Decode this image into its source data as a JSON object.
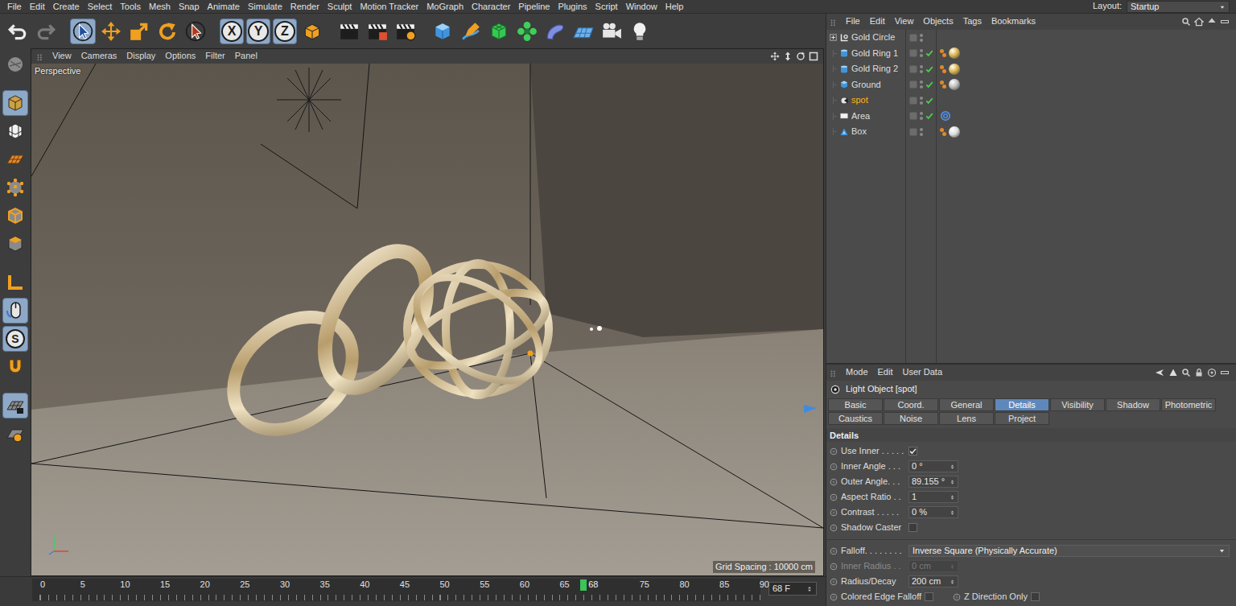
{
  "menubar": {
    "items": [
      "File",
      "Edit",
      "Create",
      "Select",
      "Tools",
      "Mesh",
      "Snap",
      "Animate",
      "Simulate",
      "Render",
      "Sculpt",
      "Motion Tracker",
      "MoGraph",
      "Character",
      "Pipeline",
      "Plugins",
      "Script",
      "Window",
      "Help"
    ],
    "layout_label": "Layout:",
    "layout_value": "Startup"
  },
  "toolbar": {
    "groups": [
      [
        {
          "kind": "undo",
          "active": false,
          "disabled": false
        },
        {
          "kind": "redo",
          "active": false,
          "disabled": true
        }
      ],
      [
        {
          "kind": "select",
          "active": true,
          "disabled": false
        },
        {
          "kind": "move",
          "active": false,
          "disabled": false
        },
        {
          "kind": "scale",
          "active": false,
          "disabled": false
        },
        {
          "kind": "rotate",
          "active": false,
          "disabled": false
        },
        {
          "kind": "live",
          "active": false,
          "disabled": false
        }
      ],
      [
        {
          "kind": "axis",
          "label": "X",
          "active": true,
          "disabled": false
        },
        {
          "kind": "axis",
          "label": "Y",
          "active": true,
          "disabled": false
        },
        {
          "kind": "axis",
          "label": "Z",
          "active": true,
          "disabled": false
        },
        {
          "kind": "coord",
          "active": false,
          "disabled": false
        }
      ],
      [
        {
          "kind": "render-view",
          "active": false,
          "disabled": false
        },
        {
          "kind": "render",
          "active": false,
          "disabled": false
        },
        {
          "kind": "render-settings",
          "active": false,
          "disabled": false
        }
      ],
      [
        {
          "kind": "cube",
          "active": false,
          "disabled": false
        },
        {
          "kind": "pen",
          "active": false,
          "disabled": false
        },
        {
          "kind": "subdiv",
          "active": false,
          "disabled": false
        },
        {
          "kind": "cloner",
          "active": false,
          "disabled": false
        },
        {
          "kind": "deformer",
          "active": false,
          "disabled": false
        },
        {
          "kind": "floor",
          "active": false,
          "disabled": false
        },
        {
          "kind": "camera",
          "active": false,
          "disabled": false
        },
        {
          "kind": "light",
          "active": false,
          "disabled": false
        }
      ]
    ]
  },
  "leftbar": {
    "groups": [
      [
        {
          "kind": "make-editable",
          "active": false
        }
      ],
      [
        {
          "kind": "model",
          "active": true
        },
        {
          "kind": "texture",
          "active": false
        },
        {
          "kind": "workplane",
          "active": false
        },
        {
          "kind": "points",
          "active": false
        },
        {
          "kind": "edges",
          "active": false
        },
        {
          "kind": "polygons",
          "active": false
        }
      ],
      [
        {
          "kind": "axis-tool",
          "active": false
        },
        {
          "kind": "tweak",
          "active": true
        },
        {
          "kind": "snap",
          "label": "S",
          "active": true
        },
        {
          "kind": "magnet",
          "active": false
        }
      ],
      [
        {
          "kind": "locked-workplane",
          "active": true
        },
        {
          "kind": "planar-workplane",
          "active": false
        }
      ]
    ]
  },
  "viewport": {
    "menu": [
      "View",
      "Cameras",
      "Display",
      "Options",
      "Filter",
      "Panel"
    ],
    "camera": "Perspective",
    "grid_spacing": "Grid Spacing : 10000 cm"
  },
  "timeline": {
    "ticks": [
      "0",
      "5",
      "10",
      "15",
      "20",
      "25",
      "30",
      "35",
      "40",
      "45",
      "50",
      "55",
      "60",
      "65",
      "75",
      "80",
      "85",
      "90"
    ],
    "current": "68",
    "frame_field": "68 F"
  },
  "object_manager": {
    "menu": [
      "File",
      "Edit",
      "View",
      "Objects",
      "Tags",
      "Bookmarks"
    ],
    "objects": [
      {
        "name": "Gold Circle",
        "kind": "null",
        "selected": false,
        "expandable": true,
        "expanded": false,
        "enabled": false,
        "tags": []
      },
      {
        "name": "Gold Ring 1",
        "kind": "cylinder",
        "selected": false,
        "expandable": false,
        "expanded": false,
        "enabled": true,
        "tags": [
          {
            "kind": "material",
            "color": "#d9b24c"
          }
        ]
      },
      {
        "name": "Gold Ring 2",
        "kind": "cylinder",
        "selected": false,
        "expandable": false,
        "expanded": false,
        "enabled": true,
        "tags": [
          {
            "kind": "material",
            "color": "#d9b24c"
          }
        ]
      },
      {
        "name": "Ground",
        "kind": "plane",
        "selected": false,
        "expandable": false,
        "expanded": false,
        "enabled": true,
        "tags": [
          {
            "kind": "material",
            "color": "#bdbdbd"
          }
        ]
      },
      {
        "name": "spot",
        "kind": "spot",
        "selected": true,
        "expandable": false,
        "expanded": false,
        "enabled": true,
        "tags": []
      },
      {
        "name": "Area",
        "kind": "area",
        "selected": false,
        "expandable": false,
        "expanded": false,
        "enabled": true,
        "tags": [
          {
            "kind": "target",
            "color": "#4f8fe6"
          }
        ]
      },
      {
        "name": "Box",
        "kind": "instance",
        "selected": false,
        "expandable": false,
        "expanded": false,
        "enabled": false,
        "tags": [
          {
            "kind": "material",
            "color": "#dcdcdc"
          }
        ]
      }
    ]
  },
  "attributes": {
    "menu": [
      "Mode",
      "Edit",
      "User Data"
    ],
    "title": "Light Object [spot]",
    "tabs": [
      {
        "label": "Basic",
        "selected": false
      },
      {
        "label": "Coord.",
        "selected": false
      },
      {
        "label": "General",
        "selected": false
      },
      {
        "label": "Details",
        "selected": true
      },
      {
        "label": "Visibility",
        "selected": false
      },
      {
        "label": "Shadow",
        "selected": false
      },
      {
        "label": "Photometric",
        "selected": false
      },
      {
        "label": "Caustics",
        "selected": false
      },
      {
        "label": "Noise",
        "selected": false
      },
      {
        "label": "Lens",
        "selected": false
      },
      {
        "label": "Project",
        "selected": false
      }
    ],
    "section": "Details",
    "groups": [
      [
        {
          "kind": "checkbox",
          "label": "Use Inner . . . . .",
          "checked": true
        },
        {
          "kind": "number",
          "label": "Inner Angle . . .",
          "value": "0 °",
          "disabled": false
        },
        {
          "kind": "number",
          "label": "Outer Angle. . .",
          "value": "89.155 °",
          "disabled": false
        },
        {
          "kind": "number",
          "label": "Aspect Ratio . .",
          "value": "1",
          "disabled": false
        },
        {
          "kind": "number",
          "label": "Contrast . . . . .",
          "value": "0 %",
          "disabled": false
        },
        {
          "kind": "checkbox",
          "label": "Shadow Caster",
          "checked": false
        }
      ],
      [
        {
          "kind": "dropdown",
          "label": "Falloff. . . . . . . .",
          "value": "Inverse Square (Physically Accurate)"
        },
        {
          "kind": "number",
          "label": "Inner Radius . .",
          "value": "0 cm",
          "disabled": true
        },
        {
          "kind": "number",
          "label": "Radius/Decay",
          "value": "200 cm",
          "disabled": false
        },
        {
          "kind": "checkbox-pair",
          "items": [
            {
              "label": "Colored Edge Falloff",
              "checked": false
            },
            {
              "label": "Z Direction Only",
              "checked": false
            }
          ]
        }
      ]
    ]
  }
}
